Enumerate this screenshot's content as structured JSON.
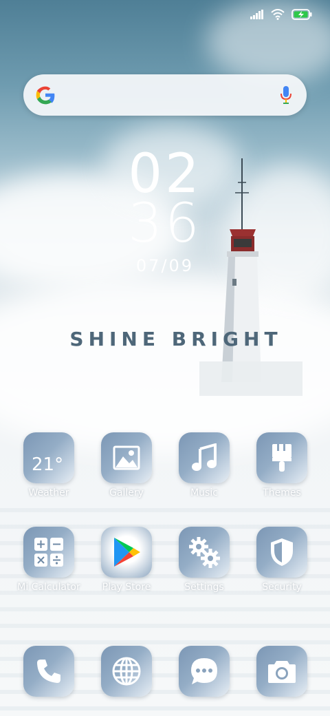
{
  "status_bar": {
    "signal_icon": "cell-signal-icon",
    "wifi_icon": "wifi-icon",
    "battery_icon": "battery-charging-icon",
    "battery_color": "#2ec84a"
  },
  "search": {
    "logo": "google-g-icon",
    "mic": "mic-icon"
  },
  "clock": {
    "hours": "02",
    "minutes": "36",
    "date": "07/09"
  },
  "wallpaper": {
    "tagline": "SHINE BRIGHT"
  },
  "apps_row1": [
    {
      "label": "Weather",
      "icon": "weather-icon",
      "temp": "21°"
    },
    {
      "label": "Gallery",
      "icon": "gallery-icon"
    },
    {
      "label": "Music",
      "icon": "music-note-icon"
    },
    {
      "label": "Themes",
      "icon": "paintbrush-icon"
    }
  ],
  "apps_row2": [
    {
      "label": "Mi Calculator",
      "icon": "calculator-icon"
    },
    {
      "label": "Play Store",
      "icon": "play-store-icon"
    },
    {
      "label": "Settings",
      "icon": "gears-icon"
    },
    {
      "label": "Security",
      "icon": "shield-icon"
    }
  ],
  "dock": [
    {
      "icon": "phone-icon"
    },
    {
      "icon": "globe-icon"
    },
    {
      "icon": "chat-bubble-icon"
    },
    {
      "icon": "camera-icon"
    }
  ]
}
